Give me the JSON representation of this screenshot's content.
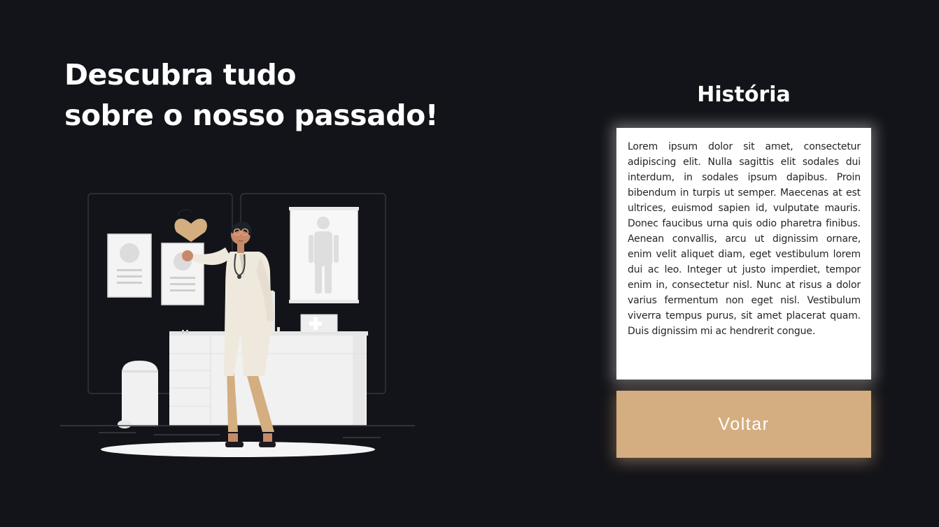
{
  "hero": {
    "line1": "Descubra tudo",
    "line2": "sobre o nosso passado!"
  },
  "illustration": {
    "subject": "doctor-in-clinic-illustration"
  },
  "history": {
    "title": "História",
    "body": "Lorem ipsum dolor sit amet, consectetur adipiscing elit. Nulla sagittis elit sodales dui interdum, in sodales ipsum dapibus. Proin bibendum in turpis ut semper. Maecenas at est ultrices, euismod sapien id, vulputate mauris. Donec faucibus urna quis odio pharetra finibus. Aenean convallis, arcu ut dignissim ornare, enim velit aliquet diam, eget vestibulum lorem dui ac leo. Integer ut justo imperdiet, tempor enim in, consectetur nisl. Nunc at risus a dolor varius fermentum non eget nisl. Vestibulum viverra tempus purus, sit amet placerat quam. Duis dignissim mi ac hendrerit congue."
  },
  "actions": {
    "back_label": "Voltar"
  },
  "colors": {
    "background": "#131419",
    "accent": "#d4ae80",
    "card": "#ffffff",
    "text_light": "#ffffff",
    "text_dark": "#222426"
  }
}
